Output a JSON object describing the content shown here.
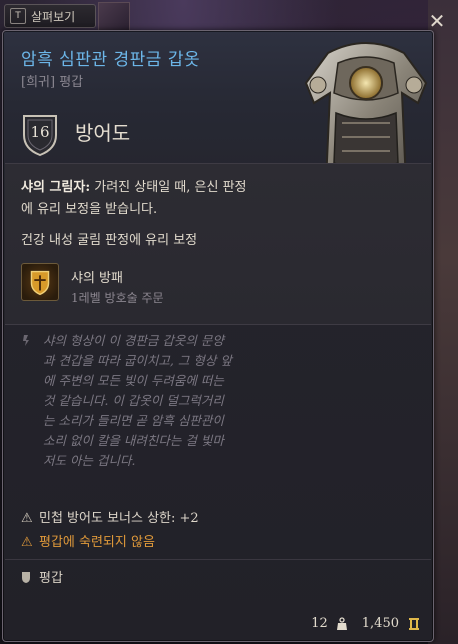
{
  "inspect": {
    "key": "T",
    "label": "살펴보기"
  },
  "close": {
    "icon": "close-icon",
    "symbol": "✕"
  },
  "item": {
    "name": "암흑 심판관 경판금 갑옷",
    "subtitle": "[희귀] 평갑",
    "name_color": "#6cb6e8"
  },
  "armor_class": {
    "value": "16",
    "label": "방어도"
  },
  "properties": {
    "shadow_title": "샤의 그림자:",
    "shadow_text": "가려진 상태일 때, 은신 판정",
    "shadow_text2": "에 유리 보정을 받습니다.",
    "constitution": "건강 내성 굴림 판정에 유리 보정"
  },
  "spell": {
    "name": "샤의 방패",
    "subtitle": "1레벨 방호술 주문",
    "icon": "shield-of-shar-icon"
  },
  "flavor": {
    "lines": [
      "샤의 형상이 이 경판금 갑옷의 문양",
      "과 견갑을 따라 굽이치고, 그 형상 앞",
      "에 주변의 모든 빛이 두려움에 떠는",
      "것 같습니다. 이 갑옷이 덜그럭거리",
      "는 소리가 들리면 곧 암흑 심판관이",
      "소리 없이 칼을 내려친다는 걸 빛마",
      "저도 아는 겁니다."
    ]
  },
  "warnings": {
    "dex_cap": "민첩 방어도 보너스 상한: +2",
    "not_proficient": "평갑에 숙련되지 않음",
    "warn_color": "#e09a3a"
  },
  "proficiency": {
    "label": "평갑"
  },
  "footer": {
    "weight": "12",
    "value": "1,450"
  }
}
